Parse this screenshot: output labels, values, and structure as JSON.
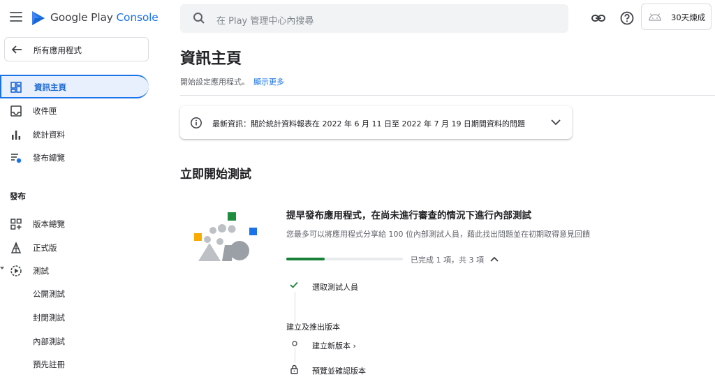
{
  "header": {
    "brand_prefix": "Google Play ",
    "brand_suffix": "Console",
    "search_placeholder": "在 Play 管理中心內搜尋",
    "account_name": "30天煉成"
  },
  "sidebar": {
    "back_label": "所有應用程式",
    "items": [
      {
        "label": "資訊主頁",
        "icon": "dashboard-icon",
        "active": true
      },
      {
        "label": "收件匣",
        "icon": "inbox-icon"
      },
      {
        "label": "統計資料",
        "icon": "bar-chart-icon"
      },
      {
        "label": "發布總覽",
        "icon": "publishing-overview-icon"
      }
    ],
    "section_release": "發布",
    "release_items": [
      {
        "label": "版本總覽",
        "icon": "releases-overview-icon"
      },
      {
        "label": "正式版",
        "icon": "production-icon"
      },
      {
        "label": "測試",
        "icon": "testing-icon"
      }
    ],
    "testing_sub": [
      "公開測試",
      "封閉測試",
      "內部測試",
      "預先註冊"
    ]
  },
  "main": {
    "title": "資訊主頁",
    "subtitle": "開始設定應用程式。",
    "show_more": "顯示更多",
    "news_text": "最新資訊：關於統計資料報表在 2022 年 6 月 11 日至 2022 年 7 月 19 日期間資料的問題",
    "section_title": "立即開始測試",
    "card": {
      "title": "提早發布應用程式，在尚未進行審查的情況下進行內部測試",
      "description": "您最多可以將應用程式分享給 100 位內部測試人員，藉此找出問題並在初期取得意見回饋",
      "progress_fraction": 0.33,
      "progress_text": "已完成 1 項，共 3 項",
      "step1": "選取測試人員",
      "group_label": "建立及推出版本",
      "step2": "建立新版本 ›",
      "step3": "預覽並確認版本"
    }
  },
  "colors": {
    "accent": "#1a73e8",
    "success": "#188038"
  }
}
